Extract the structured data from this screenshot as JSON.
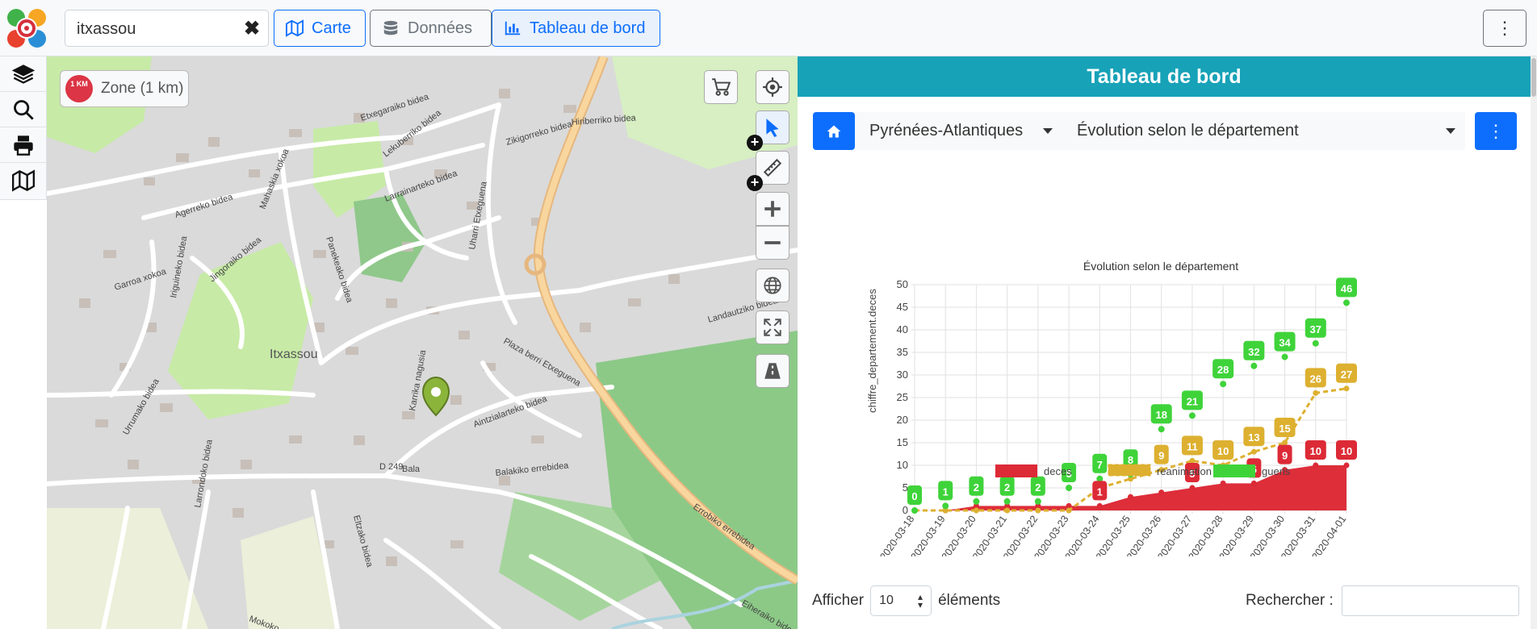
{
  "search": {
    "value": "itxassou",
    "clear_glyph": "✖"
  },
  "nav": {
    "carte": "Carte",
    "donnees": "Données",
    "tableau": "Tableau de bord",
    "menu_glyph": "⋮"
  },
  "map": {
    "zone_label": "Zone (1 km)",
    "zone_badge": "1 KM",
    "town_label": "Itxassou",
    "streets": [
      "Etxegaraiko bidea",
      "Agerreko bidea",
      "Mahaskia xokoa",
      "Larrainarteko bidea",
      "Hiriberriko bidea",
      "Zikigorreko bidea",
      "Lekuberriko bidea",
      "Panekeako bidea",
      "Uharri Etxeguena",
      "Garroa xokoa",
      "Iriguineko bidea",
      "Jingoraiko bidea",
      "Landautziko bidea",
      "Plaza berri Etxeguena",
      "Karrika nagusia",
      "Urrumako bidea",
      "Aintzialarteko bidea",
      "Bala",
      "D 249",
      "Balakiko errebidea",
      "Errobiko errebidea",
      "Larrondoko bidea",
      "Eltzako bidea",
      "Eiheraiko bidea",
      "Mokoko"
    ]
  },
  "dashboard": {
    "title": "Tableau de bord",
    "department": "Pyrénées-Atlantiques",
    "view": "Évolution selon le département",
    "menu_glyph": "⋮",
    "afficher_label": "Afficher",
    "afficher_value": "10",
    "elements_label": "éléments",
    "rechercher_label": "Rechercher :"
  },
  "chart_data": {
    "type": "area",
    "title": "Évolution selon le département",
    "ylabel": "chiffre_departement.deces",
    "xlabel": "",
    "ylim": [
      0,
      50
    ],
    "yticks": [
      0,
      5,
      10,
      15,
      20,
      25,
      30,
      35,
      40,
      45,
      50
    ],
    "categories": [
      "2020-03-18",
      "2020-03-19",
      "2020-03-20",
      "2020-03-21",
      "2020-03-22",
      "2020-03-23",
      "2020-03-24",
      "2020-03-25",
      "2020-03-26",
      "2020-03-27",
      "2020-03-28",
      "2020-03-29",
      "2020-03-30",
      "2020-03-31",
      "2020-04-01"
    ],
    "series": [
      {
        "name": "deces",
        "type": "area",
        "color": "#dc2a36",
        "values": [
          0,
          0,
          1,
          1,
          1,
          1,
          1,
          3,
          4,
          5,
          6,
          6,
          9,
          10,
          10
        ],
        "labels": [
          null,
          null,
          null,
          null,
          null,
          null,
          "1",
          null,
          null,
          "5",
          null,
          "6",
          "9",
          "10",
          "10"
        ]
      },
      {
        "name": "reanimation",
        "type": "dashed-line",
        "color": "#ddb030",
        "values": [
          0,
          0,
          0,
          0,
          0,
          0,
          5,
          7,
          9,
          11,
          10,
          13,
          15,
          26,
          27
        ],
        "labels": [
          null,
          null,
          null,
          null,
          null,
          null,
          null,
          null,
          "9",
          "11",
          "10",
          "13",
          "15",
          "26",
          "27"
        ]
      },
      {
        "name": "gueris",
        "type": "points",
        "color": "#3fd33a",
        "values": [
          0,
          1,
          2,
          2,
          2,
          5,
          7,
          8,
          18,
          21,
          28,
          32,
          34,
          37,
          46
        ],
        "labels": [
          "0",
          "1",
          "2",
          "2",
          "2",
          "5",
          "7",
          "8",
          "18",
          "21",
          "28",
          "32",
          "34",
          "37",
          "46"
        ]
      }
    ],
    "legend_position": "bottom",
    "grid": true
  }
}
